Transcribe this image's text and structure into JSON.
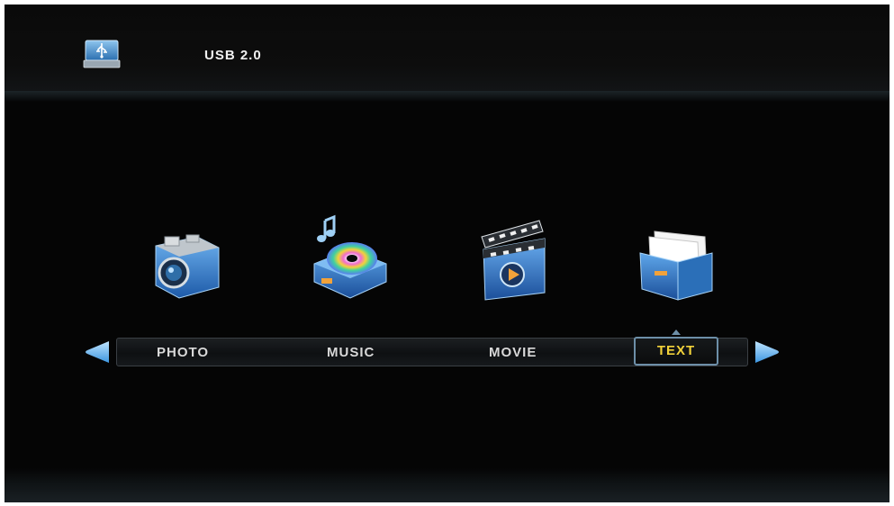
{
  "header": {
    "device_title": "USB 2.0",
    "device_icon": "usb-drive-icon"
  },
  "menu": {
    "items": [
      {
        "label": "PHOTO",
        "icon": "camera-icon",
        "selected": false
      },
      {
        "label": "MUSIC",
        "icon": "music-disc-icon",
        "selected": false
      },
      {
        "label": "MOVIE",
        "icon": "clapperboard-icon",
        "selected": false
      },
      {
        "label": "TEXT",
        "icon": "document-folder-icon",
        "selected": true
      }
    ],
    "nav_prev_icon": "arrow-left-icon",
    "nav_next_icon": "arrow-right-icon"
  },
  "colors": {
    "background": "#050505",
    "label_text": "#d8d8d8",
    "selected_text": "#f2d23a",
    "selection_border": "#6d8fa8",
    "accent_blue": "#2e7fd6"
  }
}
